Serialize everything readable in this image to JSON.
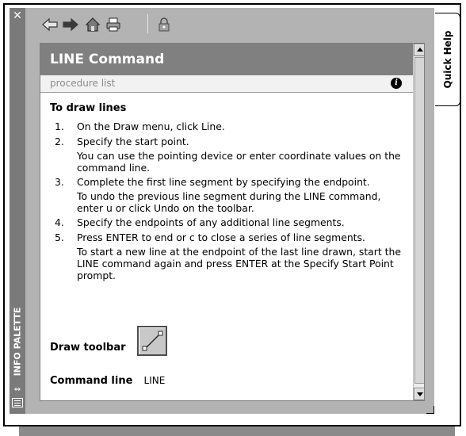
{
  "palette": {
    "close_glyph": "✕",
    "vertical_title": "INFO PALETTE",
    "side_tab_label": "Quick Help"
  },
  "toolbar": {
    "buttons": [
      {
        "name": "back-icon",
        "tooltip": ""
      },
      {
        "name": "forward-icon",
        "tooltip": ""
      },
      {
        "name": "home-icon",
        "tooltip": ""
      },
      {
        "name": "print-icon",
        "tooltip": ""
      },
      {
        "name": "lock-icon",
        "tooltip": ""
      }
    ]
  },
  "topic": {
    "title": "LINE Command",
    "tab_label": "procedure list",
    "heading": "To draw lines",
    "steps": [
      {
        "num": "1.",
        "text": "On the Draw menu, click Line.",
        "note": ""
      },
      {
        "num": "2.",
        "text": "Specify the start point.",
        "note": "You can use the pointing device or enter coordinate values on the command line."
      },
      {
        "num": "3.",
        "text": "Complete the first line segment by specifying the endpoint.",
        "note": "To undo the previous line segment during the LINE command, enter u or click Undo on the toolbar."
      },
      {
        "num": "4.",
        "text": "Specify the endpoints of any additional line segments.",
        "note": ""
      },
      {
        "num": "5.",
        "text": "Press ENTER to end or c to close a series of line segments.",
        "note": "To start a new line at the endpoint of the last line drawn, start the LINE command again and press ENTER at the Specify Start Point prompt."
      }
    ],
    "draw_toolbar_label": "Draw toolbar",
    "command_line_label": "Command line",
    "command_line_value": "LINE"
  },
  "colors": {
    "banner": "#808080",
    "palette_bg": "#b3b3b3",
    "titlebar": "#7a7a7a"
  }
}
